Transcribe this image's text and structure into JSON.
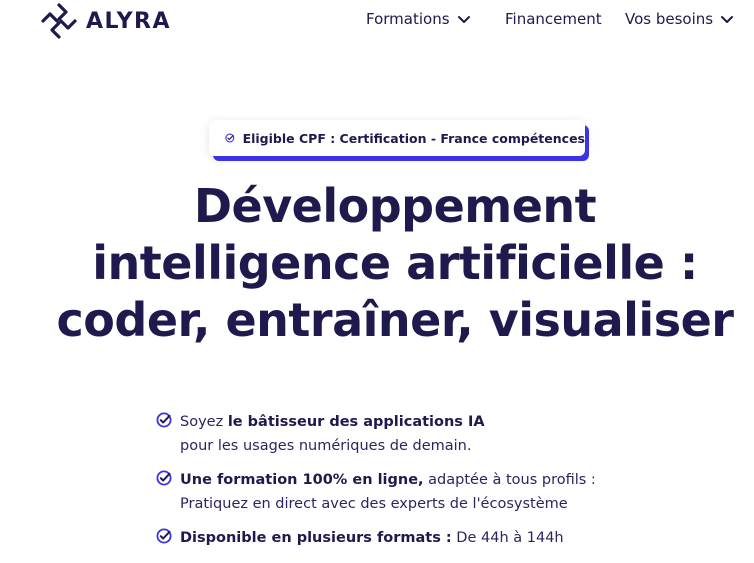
{
  "header": {
    "logo_text": "ALYRA",
    "nav": [
      {
        "label": "Formations",
        "has_dropdown": true
      },
      {
        "label": "Financement",
        "has_dropdown": false
      },
      {
        "label": "Vos besoins",
        "has_dropdown": true
      }
    ]
  },
  "badge": {
    "text": "Eligible CPF : Certification - France compétences"
  },
  "hero": {
    "title_lines": [
      "Développement",
      "intelligence artificielle :",
      "coder, entraîner, visualiser"
    ]
  },
  "features": [
    {
      "line1_prefix": "Soyez ",
      "line1_bold": "le bâtisseur des applications IA",
      "line1_suffix": "",
      "line2": "pour les usages numériques de demain."
    },
    {
      "line1_prefix": "",
      "line1_bold": "Une formation 100% en ligne,",
      "line1_suffix": " adaptée à tous profils :",
      "line2": "Pratiquez en direct avec des experts de l'écosystème"
    },
    {
      "line1_prefix": "",
      "line1_bold": "Disponible en plusieurs formats :",
      "line1_suffix": " De 44h à 144h",
      "line2": ""
    }
  ],
  "colors": {
    "navy": "#1f1a4d",
    "accent": "#3b34e6",
    "background": "#ffffff"
  },
  "icons": [
    "alyra-logo-icon",
    "chevron-down-icon",
    "check-circle-icon"
  ]
}
